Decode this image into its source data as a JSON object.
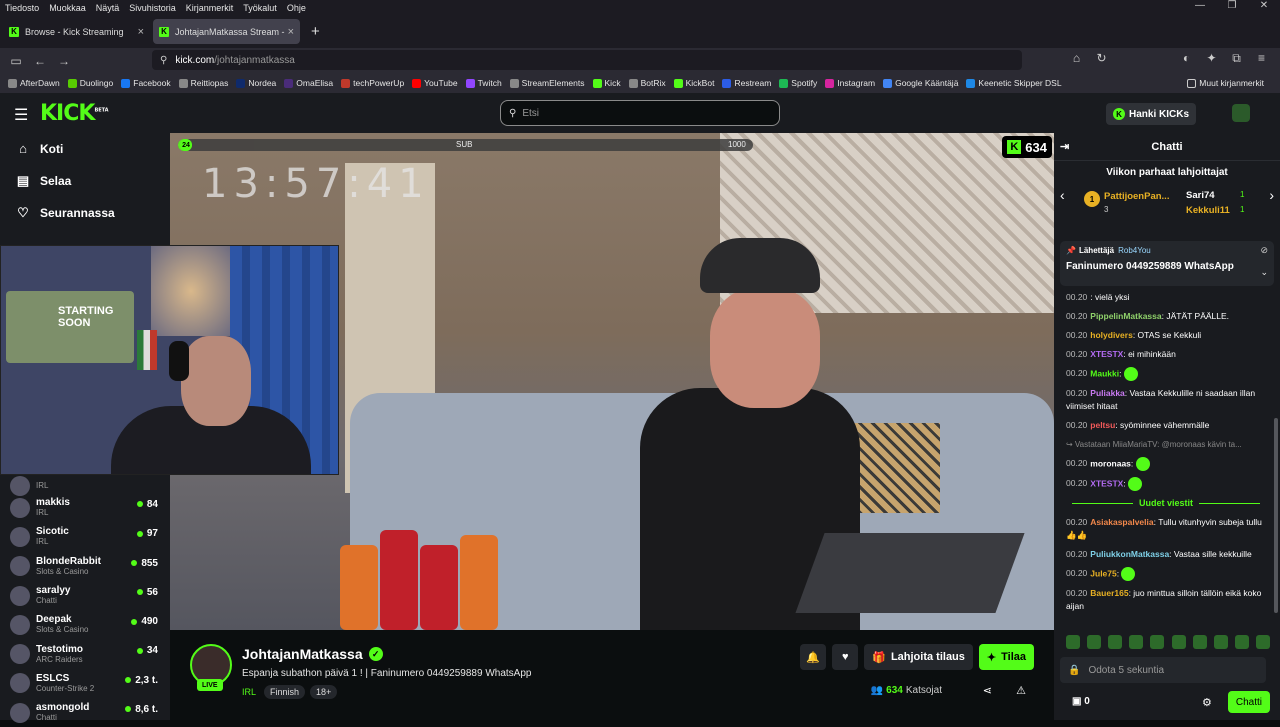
{
  "menubar": {
    "items": [
      "Tiedosto",
      "Muokkaa",
      "Näytä",
      "Sivuhistoria",
      "Kirjanmerkit",
      "Työkalut",
      "Ohje"
    ]
  },
  "tabs": [
    {
      "title": "Browse - Kick Streaming",
      "close": "×"
    },
    {
      "title": "JohtajanMatkassa Stream -",
      "close": "×"
    }
  ],
  "newtab": "+",
  "url": {
    "host": "kick.com",
    "path": "/johtajanmatkassa"
  },
  "bookmarks": [
    "AfterDawn",
    "Duolingo",
    "Facebook",
    "Reittiopas",
    "Nordea",
    "OmaElisa",
    "techPowerUp",
    "YouTube",
    "Twitch",
    "StreamElements",
    "Kick",
    "BotRix",
    "KickBot",
    "Restream",
    "Spotify",
    "Instagram",
    "Google Kääntäjä",
    "Keenetic Skipper DSL"
  ],
  "other_bookmarks": "Muut kirjanmerkit",
  "kick": {
    "logo": "KICK",
    "beta": "BETA",
    "search_placeholder": "Etsi",
    "get_kicks": "Hanki KICKs",
    "nav": [
      {
        "label": "Koti",
        "icon": "home-icon"
      },
      {
        "label": "Selaa",
        "icon": "browse-icon"
      },
      {
        "label": "Seurannassa",
        "icon": "heart-icon"
      }
    ]
  },
  "sidebar_streams": [
    {
      "name": "",
      "category": "IRL",
      "viewers": ""
    },
    {
      "name": "makkis",
      "category": "IRL",
      "viewers": "84"
    },
    {
      "name": "Sicotic",
      "category": "IRL",
      "viewers": "97"
    },
    {
      "name": "BlondeRabbit",
      "category": "Slots & Casino",
      "viewers": "855"
    },
    {
      "name": "saralyy",
      "category": "Chatti",
      "viewers": "56"
    },
    {
      "name": "Deepak",
      "category": "Slots & Casino",
      "viewers": "490"
    },
    {
      "name": "Testotimo",
      "category": "ARC Raiders",
      "viewers": "34"
    },
    {
      "name": "ESLCS",
      "category": "Counter-Strike 2",
      "viewers": "2,3 t."
    },
    {
      "name": "asmongold",
      "category": "Chatti",
      "viewers": "8,6 t."
    }
  ],
  "overlay": {
    "sub_start": "24",
    "sub_label": "SUB",
    "sub_goal": "1000",
    "sub_progress": 0.024,
    "timer": "13:57:41",
    "viewer_count": "634",
    "poster_text": "STARTING SOON"
  },
  "channel": {
    "name": "JohtajanMatkassa",
    "live": "LIVE",
    "title": "Espanja subathon päivä 1 ! | Faninumero 0449259889 WhatsApp",
    "category": "IRL",
    "tags": [
      "Finnish",
      "18+"
    ],
    "gift_label": "Lahjoita tilaus",
    "sub_label": "Tilaa",
    "viewers": "634",
    "viewers_label": "Katsojat"
  },
  "chat": {
    "title": "Chatti",
    "gifters_title": "Viikon parhaat lahjoittajat",
    "gifters": [
      {
        "rank": "1",
        "name": "PattijoenPan...",
        "count": "3"
      },
      {
        "name": "Sari74",
        "count": "1"
      },
      {
        "name": "Kekkuli11",
        "count": "1"
      }
    ],
    "pinned_by_label": "Lähettäjä",
    "pinned_by": "Rob4You",
    "pinned_msg": "Faninumero 0449259889 WhatsApp",
    "messages": [
      {
        "ts": "00.20",
        "user": "",
        "text": "vielä yksi",
        "color": "#e6e6e6"
      },
      {
        "ts": "00.20",
        "user": "PippelinMatkassa",
        "text": "JÄTÄT PÄÄLLE.",
        "color": "#8fd16a"
      },
      {
        "ts": "00.20",
        "user": "holydivers",
        "text": "OTAS se Kekkuli",
        "color": "#e8b124"
      },
      {
        "ts": "00.20",
        "user": "XTESTX",
        "text": "ei mihinkään",
        "color": "#b36bf2"
      },
      {
        "ts": "00.20",
        "user": "Maukki",
        "text": "",
        "color": "#53fc18",
        "emote": true
      },
      {
        "ts": "00.20",
        "user": "Puliakka",
        "text": "Vastaa Kekkulille ni saadaan illan viimiset hitaat",
        "color": "#c97bf2"
      },
      {
        "ts": "00.20",
        "user": "peltsu",
        "text": "syöminnee vähemmälle",
        "color": "#f25a5a"
      }
    ],
    "reply": "↪ Vastataan MiiaMariaTV: @moronaas kävin ta...",
    "messages2": [
      {
        "ts": "00.20",
        "user": "moronaas",
        "text": "",
        "color": "#ffffff",
        "emote": true
      },
      {
        "ts": "00.20",
        "user": "XTESTX",
        "text": "",
        "color": "#b36bf2",
        "emote": true
      }
    ],
    "new_messages": "Uudet viestit",
    "messages3": [
      {
        "ts": "00.20",
        "user": "Asiakaspalvelia",
        "text": "Tullu vitunhyvin subeja tullu 👍👍",
        "color": "#f2884b"
      },
      {
        "ts": "00.20",
        "user": "PuliukkonMatkassa",
        "text": "Vastaa sille kekkuille",
        "color": "#7fd1e8"
      },
      {
        "ts": "00.20",
        "user": "Jule75",
        "text": "",
        "color": "#e8b124",
        "emote": true
      },
      {
        "ts": "00.20",
        "user": "Bauer165",
        "text": "juo minttua silloin tällöin eikä koko aijan",
        "color": "#e8b124"
      }
    ],
    "input_placeholder": "Odota 5 sekuntia",
    "points": "0",
    "send": "Chatti"
  },
  "colors": {
    "accent": "#53fc18",
    "bg": "#0b0e0f",
    "panel": "#191b1f"
  }
}
